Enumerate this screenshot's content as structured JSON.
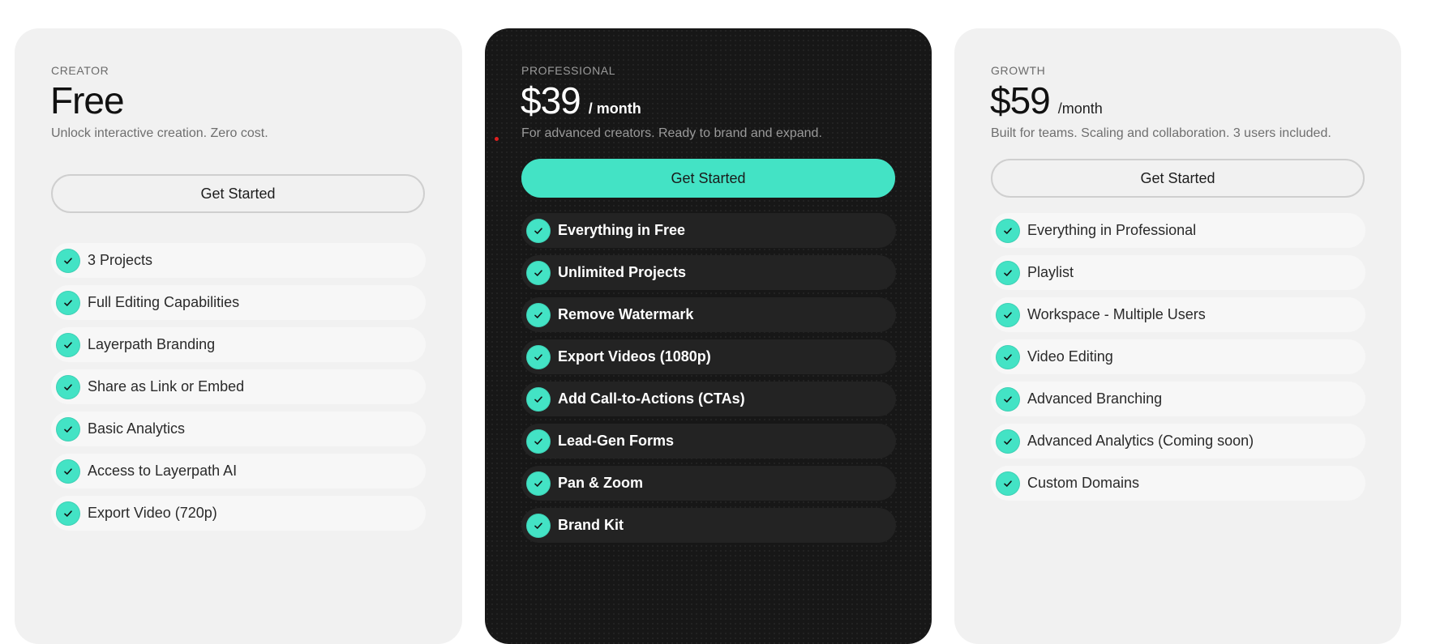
{
  "colors": {
    "accent": "#43e3c5",
    "card_light": "#f1f1f1",
    "card_dark": "#171717",
    "pill_light": "#f7f7f7",
    "pill_dark": "#232323"
  },
  "plans": {
    "creator": {
      "tier": "CREATOR",
      "price": "Free",
      "period": "",
      "description": "Unlock interactive creation. Zero cost.",
      "cta_label": "Get Started",
      "features": [
        "3 Projects",
        "Full Editing Capabilities",
        "Layerpath Branding",
        "Share as Link or Embed",
        "Basic Analytics",
        "Access to Layerpath AI",
        "Export Video (720p)"
      ]
    },
    "professional": {
      "tier": "PROFESSIONAL",
      "price": "$39",
      "period": "/ month",
      "description": "For advanced creators. Ready to brand and expand.",
      "cta_label": "Get Started",
      "features": [
        "Everything in Free",
        "Unlimited Projects",
        "Remove Watermark",
        "Export Videos (1080p)",
        "Add Call-to-Actions (CTAs)",
        "Lead-Gen Forms",
        "Pan & Zoom",
        "Brand Kit"
      ]
    },
    "growth": {
      "tier": "GROWTH",
      "price": "$59",
      "period": "/month",
      "description": "Built for teams. Scaling and collaboration. 3 users included.",
      "cta_label": "Get Started",
      "features": [
        "Everything in Professional",
        "Playlist",
        "Workspace - Multiple Users",
        "Video Editing",
        "Advanced Branching",
        "Advanced Analytics (Coming soon)",
        "Custom Domains"
      ]
    }
  },
  "icons": {
    "feature_check": "check-circle-icon"
  }
}
